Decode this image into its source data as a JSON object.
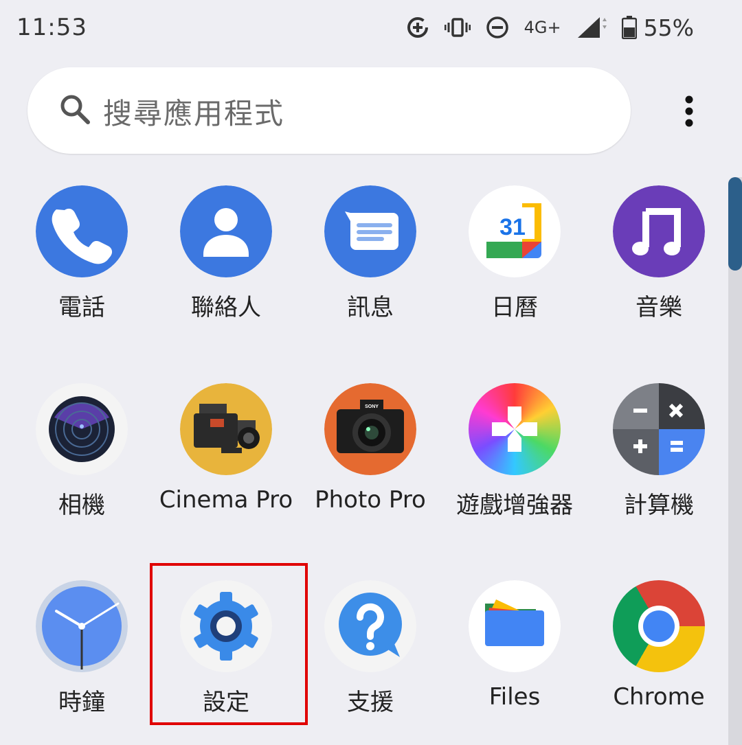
{
  "status_bar": {
    "time": "11:53",
    "network": "4G+",
    "battery": "55%",
    "icons": [
      "data-saver-icon",
      "vibrate-icon",
      "do-not-disturb-icon",
      "network-4g-icon",
      "signal-icon",
      "battery-icon"
    ]
  },
  "search": {
    "placeholder": "搜尋應用程式",
    "icon": "search-icon"
  },
  "menu": {
    "icon": "more-vert-icon"
  },
  "apps": [
    {
      "label": "電話",
      "icon": "phone-icon"
    },
    {
      "label": "聯絡人",
      "icon": "contacts-icon"
    },
    {
      "label": "訊息",
      "icon": "messages-icon"
    },
    {
      "label": "日曆",
      "icon": "calendar-icon",
      "icon_text": "31"
    },
    {
      "label": "音樂",
      "icon": "music-icon"
    },
    {
      "label": "相機",
      "icon": "camera-icon"
    },
    {
      "label": "Cinema Pro",
      "icon": "cinema-pro-icon"
    },
    {
      "label": "Photo Pro",
      "icon": "photo-pro-icon",
      "icon_text": "SONY"
    },
    {
      "label": "遊戲增強器",
      "icon": "game-enhancer-icon"
    },
    {
      "label": "計算機",
      "icon": "calculator-icon"
    },
    {
      "label": "時鐘",
      "icon": "clock-icon"
    },
    {
      "label": "設定",
      "icon": "settings-icon",
      "highlighted": true
    },
    {
      "label": "支援",
      "icon": "support-icon"
    },
    {
      "label": "Files",
      "icon": "files-icon"
    },
    {
      "label": "Chrome",
      "icon": "chrome-icon"
    }
  ],
  "colors": {
    "background": "#eeeef3",
    "highlight": "#e00000",
    "accent_blue": "#3c78e0",
    "scrollbar": "#2c5f8a"
  }
}
